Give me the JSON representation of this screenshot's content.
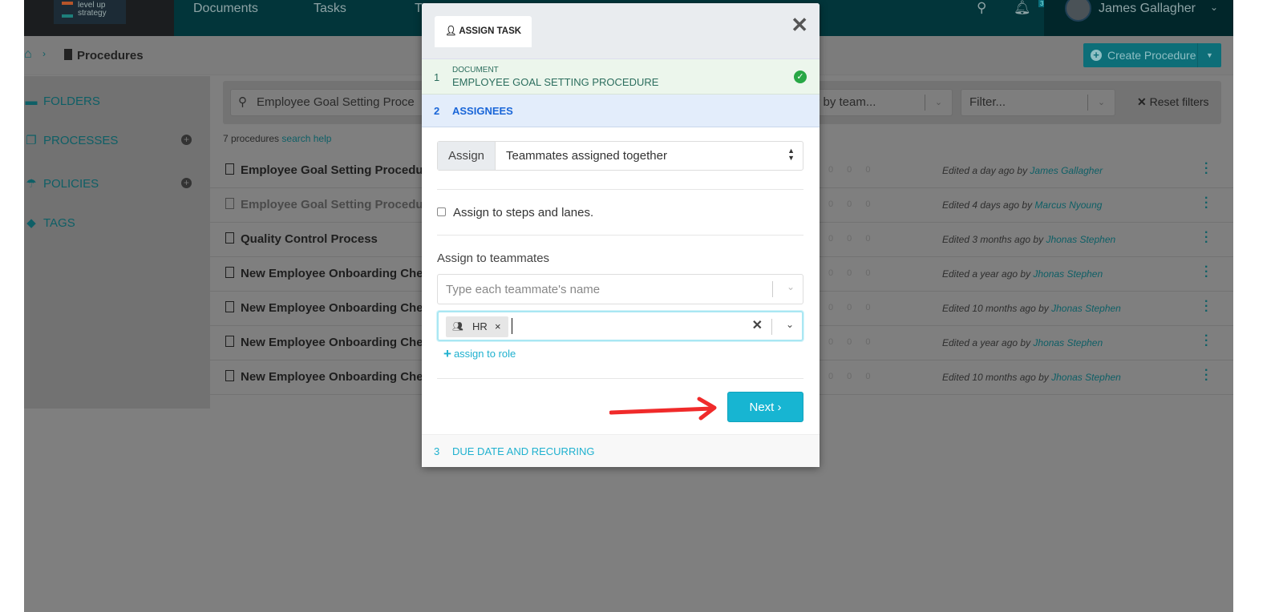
{
  "header": {
    "logo": "level up strategy",
    "nav": [
      "Documents",
      "Tasks",
      "T"
    ],
    "notifications": "3",
    "user": "James Gallagher"
  },
  "breadcrumb": {
    "title": "Procedures"
  },
  "create_button": "Create Procedure",
  "sidebar": {
    "items": [
      {
        "label": "FOLDERS"
      },
      {
        "label": "PROCESSES"
      },
      {
        "label": "POLICIES"
      },
      {
        "label": "TAGS"
      }
    ]
  },
  "filters": {
    "search_value": "Employee Goal Setting Proce",
    "team_placeholder": "Filter by team...",
    "filter_placeholder": "Filter...",
    "reset": "Reset filters"
  },
  "count": {
    "text": "7 procedures",
    "help": "search help"
  },
  "rows": [
    {
      "name": "Employee Goal Setting Procedu",
      "counts": "0 0 0",
      "edited": "Edited a day ago by",
      "by": "James Gallagher"
    },
    {
      "name": "Employee Goal Setting Procedu",
      "counts": "0 0 0",
      "edited": "Edited 4 days ago by",
      "by": "Marcus Nyoung"
    },
    {
      "name": "Quality Control Process",
      "counts": "0 0 0",
      "edited": "Edited 3 months ago by",
      "by": "Jhonas Stephen"
    },
    {
      "name": "New Employee Onboarding Che",
      "counts": "0 0 0",
      "edited": "Edited a year ago by",
      "by": "Jhonas Stephen"
    },
    {
      "name": "New Employee Onboarding Che",
      "counts": "0 0 0",
      "edited": "Edited 10 months ago by",
      "by": "Jhonas Stephen"
    },
    {
      "name": "New Employee Onboarding Che",
      "counts": "0 0 0",
      "edited": "Edited a year ago by",
      "by": "Jhonas Stephen"
    },
    {
      "name": "New Employee Onboarding Che",
      "counts": "0 0 0",
      "edited": "Edited 10 months ago by",
      "by": "Jhonas Stephen"
    }
  ],
  "modal": {
    "tab": "ASSIGN TASK",
    "close": "✕",
    "step1": {
      "num": "1",
      "label": "DOCUMENT",
      "value": "EMPLOYEE GOAL SETTING PROCEDURE"
    },
    "step2": {
      "num": "2",
      "label": "ASSIGNEES"
    },
    "step3": {
      "num": "3",
      "label": "DUE DATE AND RECURRING"
    },
    "assign_label": "Assign",
    "assign_value": "Teammates assigned together",
    "checkbox_label": "Assign to steps and lanes.",
    "teammates_label": "Assign to teammates",
    "teammates_placeholder": "Type each teammate's name",
    "role_chip": "HR",
    "assign_role": "assign to role",
    "next": "Next ›"
  },
  "colors": {
    "accent": "#17b5d2",
    "annotation_arrow": "#f02a2a",
    "success": "#28a745"
  }
}
